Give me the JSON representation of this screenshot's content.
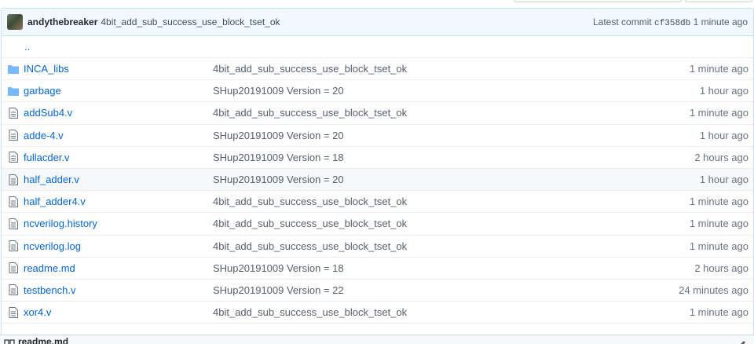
{
  "commit": {
    "author": "andythebreaker",
    "message": "4bit_add_sub_success_use_block_tset_ok",
    "latest_label": "Latest commit",
    "sha": "cf358db",
    "age": "1 minute ago"
  },
  "parent_link": "..",
  "files": [
    {
      "type": "directory",
      "icon": "folder-icon",
      "name": "INCA_libs",
      "message": "4bit_add_sub_success_use_block_tset_ok",
      "age": "1 minute ago"
    },
    {
      "type": "directory",
      "icon": "folder-icon",
      "name": "garbage",
      "message": "SHup20191009 Version = 20",
      "age": "1 hour ago"
    },
    {
      "type": "file",
      "icon": "file-icon",
      "name": "addSub4.v",
      "message": "4bit_add_sub_success_use_block_tset_ok",
      "age": "1 minute ago"
    },
    {
      "type": "file",
      "icon": "file-icon",
      "name": "adde-4.v",
      "message": "SHup20191009 Version = 20",
      "age": "1 hour ago"
    },
    {
      "type": "file",
      "icon": "file-icon",
      "name": "fullacder.v",
      "message": "SHup20191009 Version = 18",
      "age": "2 hours ago"
    },
    {
      "type": "file",
      "icon": "file-icon",
      "name": "half_adder.v",
      "message": "SHup20191009 Version = 20",
      "age": "1 hour ago"
    },
    {
      "type": "file",
      "icon": "file-icon",
      "name": "half_adder4.v",
      "message": "4bit_add_sub_success_use_block_tset_ok",
      "age": "1 minute ago"
    },
    {
      "type": "file",
      "icon": "file-icon",
      "name": "ncverilog.history",
      "message": "4bit_add_sub_success_use_block_tset_ok",
      "age": "1 minute ago"
    },
    {
      "type": "file",
      "icon": "file-icon",
      "name": "ncverilog.log",
      "message": "4bit_add_sub_success_use_block_tset_ok",
      "age": "1 minute ago"
    },
    {
      "type": "file",
      "icon": "file-icon",
      "name": "readme.md",
      "message": "SHup20191009 Version = 18",
      "age": "2 hours ago"
    },
    {
      "type": "file",
      "icon": "file-icon",
      "name": "testbench.v",
      "message": "SHup20191009 Version = 22",
      "age": "24 minutes ago"
    },
    {
      "type": "file",
      "icon": "file-icon",
      "name": "xor4.v",
      "message": "4bit_add_sub_success_use_block_tset_ok",
      "age": "1 minute ago"
    }
  ],
  "readme": {
    "title": "readme.md",
    "icon": "book-icon",
    "edit_icon": "pencil-icon"
  },
  "colors": {
    "link": "#0366d6",
    "commit_bar_bg": "#f1f8ff",
    "folder_icon": "#79b8ff",
    "file_icon": "#6a737d"
  }
}
